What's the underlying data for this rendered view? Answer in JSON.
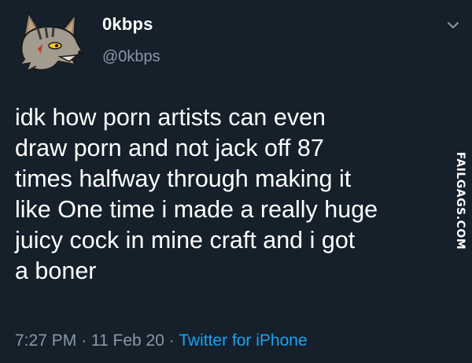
{
  "tweet": {
    "display_name": "0kbps",
    "handle": "@0kbps",
    "text": "idk how porn artists can even\ndraw porn and not jack off 87\ntimes halfway through making it\nlike One time i made a really huge\njuicy cock in mine craft  and i got\na boner",
    "time": "7:27 PM",
    "separator": "·",
    "date": "11 Feb 20",
    "source": "Twitter for iPhone"
  },
  "avatar_icon": "wolf-avatar-icon",
  "menu_icon": "chevron-down-icon",
  "watermark": "FAILGAGS.COM",
  "colors": {
    "background": "#15202b",
    "text": "#ffffff",
    "secondary_text": "#8899a6",
    "link": "#1da1f2"
  }
}
